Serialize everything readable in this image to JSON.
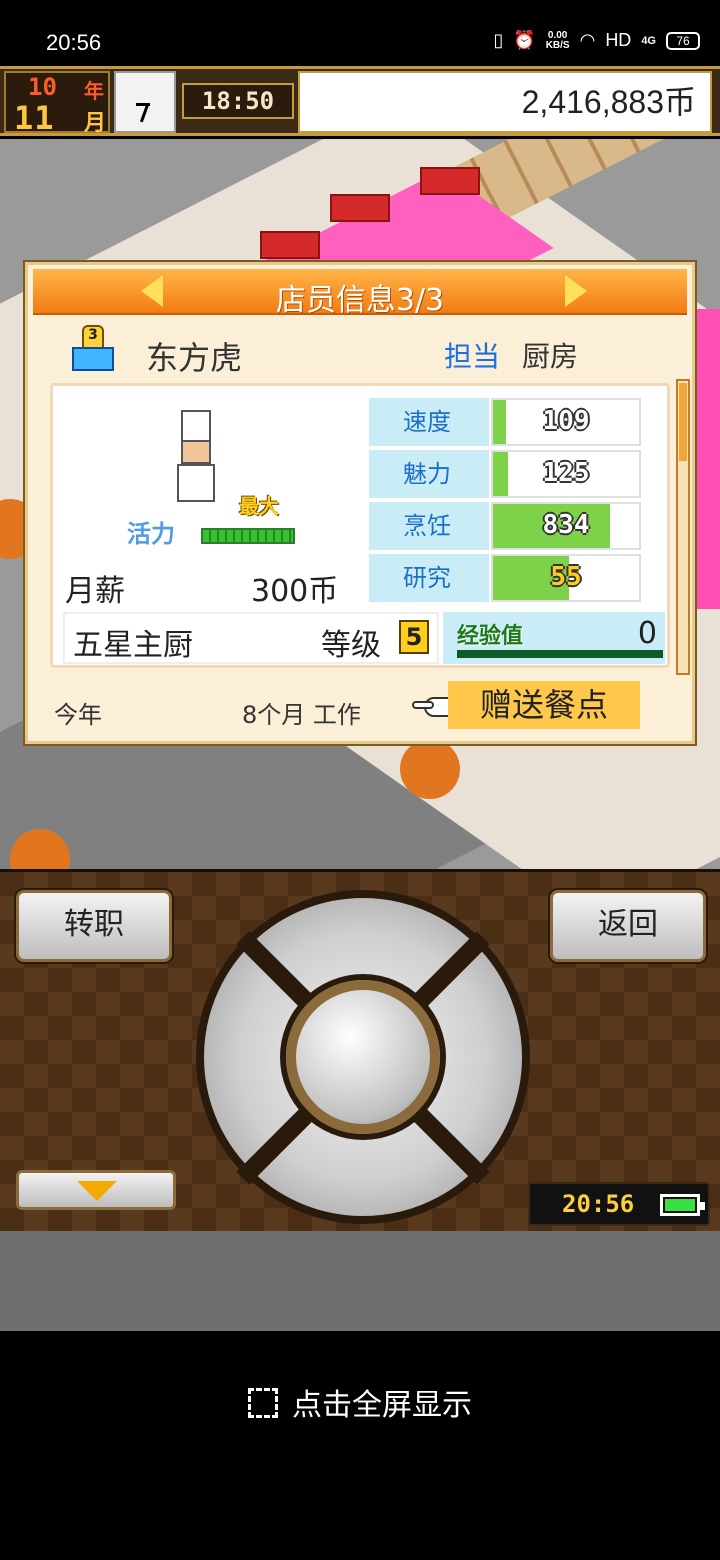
{
  "status_bar": {
    "time": "20:56",
    "net_speed": "0.00",
    "net_unit": "KB/S",
    "hd": "HD",
    "signal": "4G",
    "battery": "76"
  },
  "top_bar": {
    "year_num": "10",
    "year_label": "年",
    "month_num": "11",
    "month_label": "月",
    "game_time": "18:50",
    "money": "2,416,883币"
  },
  "dialog": {
    "title": "店员信息3/3",
    "badge_num": "3",
    "employee_name": "东方虎",
    "role_label": "担当",
    "role_value": "厨房",
    "max_label": "最大",
    "vigor_label": "活力",
    "salary_label": "月薪",
    "salary_value": "300币",
    "stats": [
      {
        "label": "速度",
        "value": "109",
        "level": 0.09
      },
      {
        "label": "魅力",
        "value": "125",
        "level": 0.1
      },
      {
        "label": "烹饪",
        "value": "834",
        "level": 0.8
      },
      {
        "label": "研究",
        "value": "55",
        "level": 0.52
      }
    ],
    "rank_title": "五星主厨",
    "level_label": "等级",
    "level_value": "5",
    "exp_label": "经验值",
    "exp_value": "0",
    "year_label": "今年",
    "work_months": "8个月 工作",
    "gift_button": "赠送餐点"
  },
  "controller": {
    "left_button": "转职",
    "right_button": "返回",
    "clock": "20:56"
  },
  "fullscreen_label": "点击全屏显示"
}
